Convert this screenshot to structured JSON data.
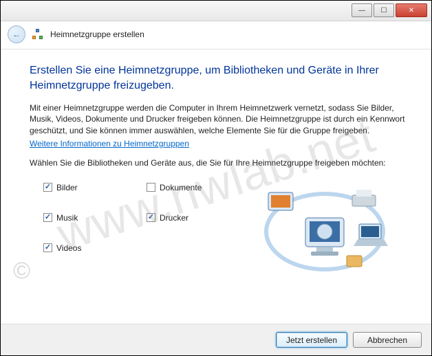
{
  "window": {
    "minimize_glyph": "—",
    "maximize_glyph": "☐",
    "close_glyph": "✕"
  },
  "header": {
    "back_glyph": "←",
    "title": "Heimnetzgruppe erstellen"
  },
  "main": {
    "heading": "Erstellen Sie eine Heimnetzgruppe, um Bibliotheken und Geräte in Ihrer Heimnetzgruppe freizugeben.",
    "description": "Mit einer Heimnetzgruppe werden die Computer in Ihrem Heimnetzwerk vernetzt, sodass Sie Bilder, Musik, Videos, Dokumente und Drucker freigeben können. Die Heimnetzgruppe ist durch ein Kennwort geschützt, und Sie können immer auswählen, welche Elemente Sie für die Gruppe freigeben.",
    "link_text": "Weitere Informationen zu Heimnetzgruppen",
    "prompt": "Wählen Sie die Bibliotheken und Geräte aus, die Sie für Ihre Heimnetzgruppe freigeben möchten:"
  },
  "options": {
    "bilder": {
      "label": "Bilder",
      "checked": true
    },
    "dokumente": {
      "label": "Dokumente",
      "checked": false
    },
    "musik": {
      "label": "Musik",
      "checked": true
    },
    "drucker": {
      "label": "Drucker",
      "checked": true
    },
    "videos": {
      "label": "Videos",
      "checked": true
    }
  },
  "footer": {
    "primary": "Jetzt erstellen",
    "cancel": "Abbrechen"
  },
  "watermark": {
    "text": "www.nwlab.net",
    "copyright": "©"
  }
}
